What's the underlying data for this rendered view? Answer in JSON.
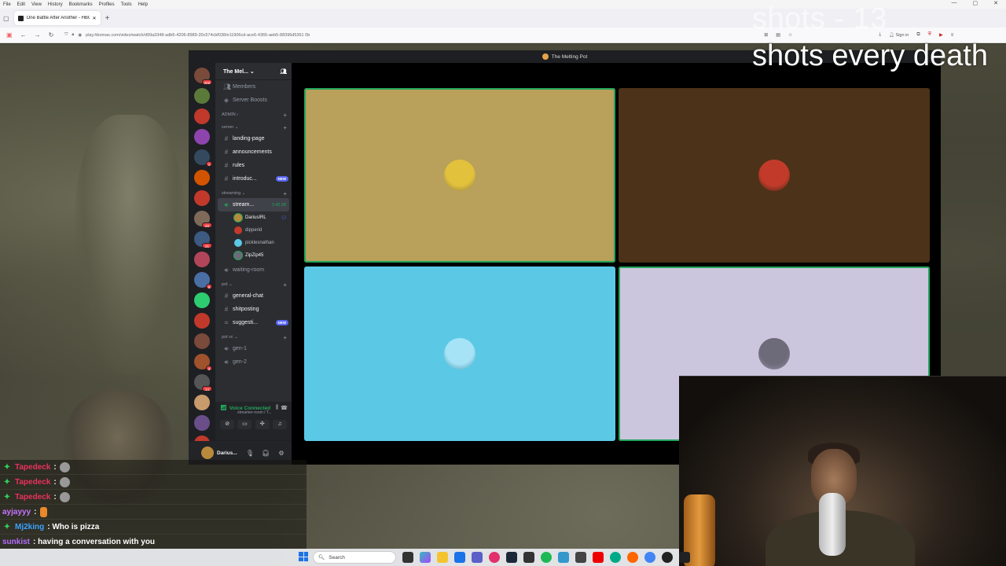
{
  "browser": {
    "menu": [
      "File",
      "Edit",
      "View",
      "History",
      "Bookmarks",
      "Profiles",
      "Tools",
      "Help"
    ],
    "tab_title": "One Battle After Another - HBO",
    "url": "play.hbomax.com/video/watch/d99a3348-adb5-4206-8989-20c574cbf038/e11906cd-ace6-4365-aeb5-88396d5361 0b",
    "sign_in": "Sign in"
  },
  "overlay": {
    "counter": "shots - 13",
    "rule": "shots every death"
  },
  "discord": {
    "window_title": "The Melting Pot",
    "server_name": "The Mel...",
    "guild_badges": [
      "202",
      "",
      "",
      "",
      "1",
      "",
      "",
      "20",
      "21",
      "",
      "6",
      "",
      "",
      "",
      "3",
      "14",
      "",
      "",
      "NEW"
    ],
    "top_items": [
      {
        "label": "Members",
        "icon": "members-icon"
      },
      {
        "label": "Server Boosts",
        "icon": "boost-icon"
      }
    ],
    "categories": {
      "admin": "ADMIN",
      "server": "server",
      "streaming": "streaming",
      "pot": "pot",
      "pot_vc": "pot vc"
    },
    "server_channels": [
      {
        "name": "landing-page"
      },
      {
        "name": "announcements"
      },
      {
        "name": "rules"
      },
      {
        "name": "introduc...",
        "pill": "NEW"
      }
    ],
    "streaming_channel": {
      "name": "stream...",
      "timer": "1:42:28"
    },
    "voice_users": [
      "DariusIRL",
      "dipperid",
      "picklesnathan",
      "ZipZip45"
    ],
    "waiting_room": "waiting-room",
    "pot_channels": [
      {
        "name": "general-chat"
      },
      {
        "name": "shitposting"
      },
      {
        "name": "suggesti...",
        "pill": "NEW"
      }
    ],
    "pot_vc_channels": [
      "gen-1",
      "gen-2"
    ],
    "voice_status": "Voice Connected",
    "voice_sub": "streamer-room / T...",
    "user_name": "Darius...",
    "tiles": [
      {
        "color": "#b9a05b",
        "avatar_color": "#e2c13c",
        "speaking": true
      },
      {
        "color": "#4b3218",
        "avatar_color": "#c23b2a",
        "speaking": false
      },
      {
        "color": "#5bc9e6",
        "avatar_color": "#a6e3f7",
        "speaking": false
      },
      {
        "color": "#ccc5de",
        "avatar_color": "#6d6a7a",
        "speaking": true
      }
    ]
  },
  "chat": [
    {
      "user": "Tapedeck",
      "color": "#e9315b",
      "message": ":",
      "emote": true
    },
    {
      "user": "Tapedeck",
      "color": "#e9315b",
      "message": ":",
      "emote": true
    },
    {
      "user": "Tapedeck",
      "color": "#e9315b",
      "message": ":",
      "emote": true
    },
    {
      "user": "ayjayyy",
      "color": "#c873ff",
      "message": ":",
      "emote": true,
      "mod": false
    },
    {
      "user": "Mj2king",
      "color": "#3aa3ff",
      "message": ": Who is pizza"
    },
    {
      "user": "sunkist",
      "color": "#b46cff",
      "message": ": having a conversation with you",
      "mod": false
    }
  ],
  "taskbar": {
    "search_placeholder": "Search"
  }
}
